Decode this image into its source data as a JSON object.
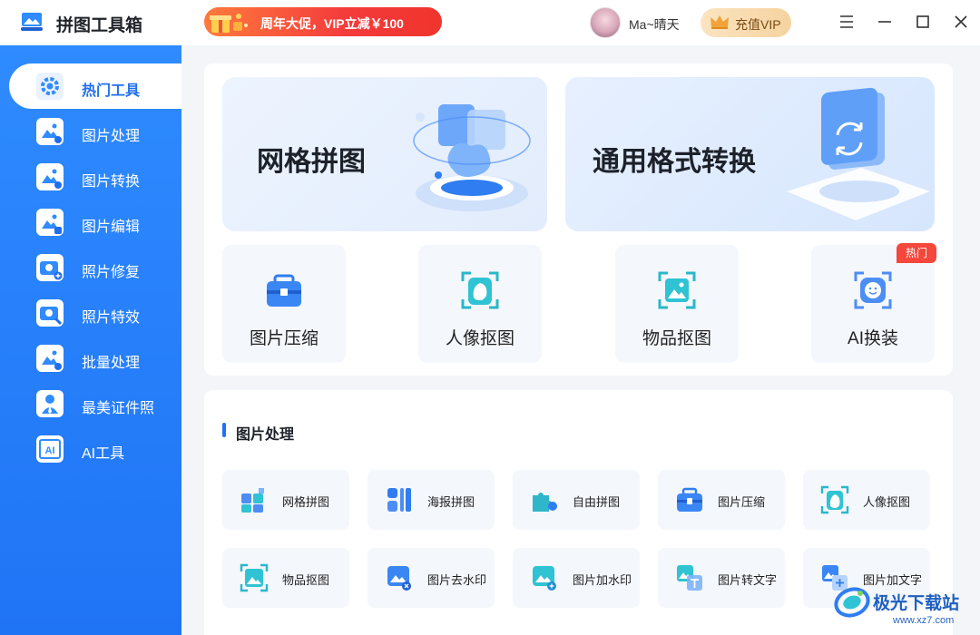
{
  "app": {
    "title": "拼图工具箱",
    "logo_icon": "app-logo-icon"
  },
  "promo": {
    "text": "周年大促，VIP立减￥100",
    "icon": "gift-icon"
  },
  "user": {
    "name": "Ma~晴天",
    "avatar_icon": "user-avatar"
  },
  "vip": {
    "label": "充值VIP",
    "icon": "crown-icon"
  },
  "window_controls": [
    "menu-icon",
    "minimize-icon",
    "maximize-icon",
    "close-icon"
  ],
  "sidebar": {
    "items": [
      {
        "label": "热门工具",
        "icon": "gear-icon",
        "active": true
      },
      {
        "label": "图片处理",
        "icon": "image-process-icon"
      },
      {
        "label": "图片转换",
        "icon": "image-convert-icon"
      },
      {
        "label": "图片编辑",
        "icon": "image-edit-icon"
      },
      {
        "label": "照片修复",
        "icon": "camera-repair-icon"
      },
      {
        "label": "照片特效",
        "icon": "camera-effect-icon"
      },
      {
        "label": "批量处理",
        "icon": "batch-icon"
      },
      {
        "label": "最美证件照",
        "icon": "id-photo-icon"
      },
      {
        "label": "AI工具",
        "icon": "ai-icon"
      }
    ]
  },
  "banners": [
    {
      "title": "网格拼图",
      "icon": "puzzle-illustration"
    },
    {
      "title": "通用格式转换",
      "icon": "convert-illustration"
    }
  ],
  "quick_tools": [
    {
      "label": "图片压缩",
      "icon": "compress-icon"
    },
    {
      "label": "人像抠图",
      "icon": "portrait-cutout-icon"
    },
    {
      "label": "物品抠图",
      "icon": "object-cutout-icon"
    },
    {
      "label": "AI换装",
      "icon": "ai-outfit-icon",
      "badge": "热门"
    }
  ],
  "section": {
    "title": "图片处理",
    "tools": [
      {
        "label": "网格拼图",
        "icon": "grid-puzzle-icon"
      },
      {
        "label": "海报拼图",
        "icon": "poster-icon"
      },
      {
        "label": "自由拼图",
        "icon": "free-puzzle-icon"
      },
      {
        "label": "图片压缩",
        "icon": "compress-icon"
      },
      {
        "label": "人像抠图",
        "icon": "portrait-cutout-icon"
      },
      {
        "label": "物品抠图",
        "icon": "object-cutout-icon"
      },
      {
        "label": "图片去水印",
        "icon": "remove-watermark-icon"
      },
      {
        "label": "图片加水印",
        "icon": "add-watermark-icon"
      },
      {
        "label": "图片转文字",
        "icon": "image-to-text-icon"
      },
      {
        "label": "图片加文字",
        "icon": "add-text-icon"
      }
    ]
  },
  "watermark": {
    "name": "极光下载站",
    "url": "www.xz7.com"
  },
  "colors": {
    "primary": "#1f74f5",
    "sidebar": "#2f8bff",
    "hot": "#f5473b",
    "vip": "#f6d3a0"
  }
}
